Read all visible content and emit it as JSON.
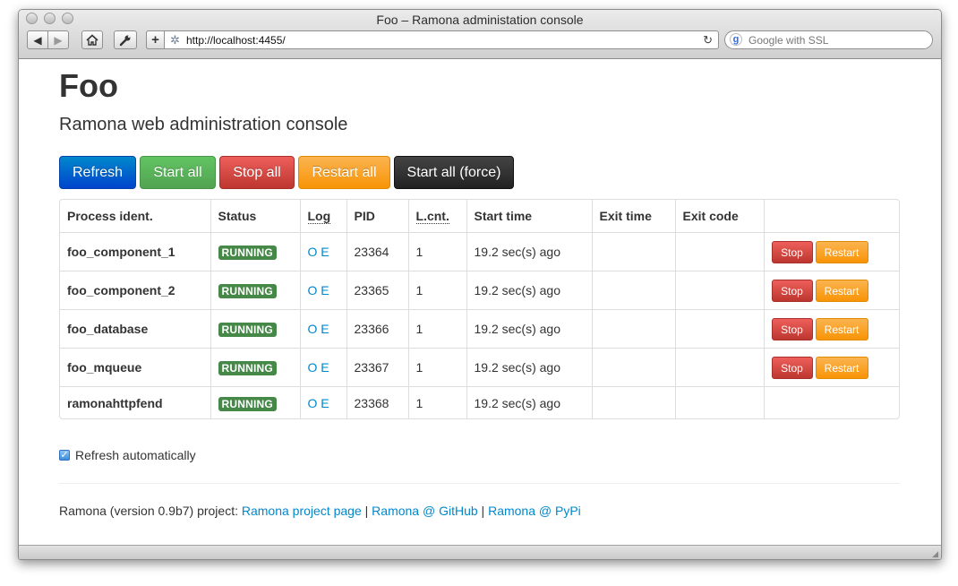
{
  "browser": {
    "title": "Foo – Ramona administation console",
    "url": "http://localhost:4455/",
    "search_placeholder": "Google with SSL"
  },
  "page": {
    "heading": "Foo",
    "subtitle": "Ramona web administration console",
    "buttons": {
      "refresh": "Refresh",
      "start_all": "Start all",
      "stop_all": "Stop all",
      "restart_all": "Restart all",
      "start_all_force": "Start all (force)"
    },
    "table": {
      "headers": [
        "Process ident.",
        "Status",
        "Log",
        "PID",
        "L.cnt.",
        "Start time",
        "Exit time",
        "Exit code",
        ""
      ],
      "rows": [
        {
          "name": "foo_component_1",
          "status": "RUNNING",
          "log_o": "O",
          "log_e": "E",
          "pid": "23364",
          "lcnt": "1",
          "start": "19.2 sec(s) ago",
          "exit_time": "",
          "exit_code": "",
          "stop": "Stop",
          "restart": "Restart"
        },
        {
          "name": "foo_component_2",
          "status": "RUNNING",
          "log_o": "O",
          "log_e": "E",
          "pid": "23365",
          "lcnt": "1",
          "start": "19.2 sec(s) ago",
          "exit_time": "",
          "exit_code": "",
          "stop": "Stop",
          "restart": "Restart"
        },
        {
          "name": "foo_database",
          "status": "RUNNING",
          "log_o": "O",
          "log_e": "E",
          "pid": "23366",
          "lcnt": "1",
          "start": "19.2 sec(s) ago",
          "exit_time": "",
          "exit_code": "",
          "stop": "Stop",
          "restart": "Restart"
        },
        {
          "name": "foo_mqueue",
          "status": "RUNNING",
          "log_o": "O",
          "log_e": "E",
          "pid": "23367",
          "lcnt": "1",
          "start": "19.2 sec(s) ago",
          "exit_time": "",
          "exit_code": "",
          "stop": "Stop",
          "restart": "Restart"
        },
        {
          "name": "ramonahttpfend",
          "status": "RUNNING",
          "log_o": "O",
          "log_e": "E",
          "pid": "23368",
          "lcnt": "1",
          "start": "19.2 sec(s) ago",
          "exit_time": "",
          "exit_code": ""
        }
      ]
    },
    "auto_refresh": {
      "label": "Refresh automatically",
      "checked": true
    },
    "footer": {
      "prefix": "Ramona (version 0.9b7) project: ",
      "link1": "Ramona project page",
      "sep": " | ",
      "link2": "Ramona @ GitHub",
      "link3": "Ramona @ PyPi"
    }
  },
  "colors": {
    "primary": "#0088cc",
    "success": "#51a351",
    "danger": "#bd362f",
    "warning": "#f89406",
    "inverse": "#222222",
    "label_success": "#468847"
  },
  "icons": [
    "back-icon",
    "forward-icon",
    "home-icon",
    "wrench-icon",
    "plus-icon",
    "gear-icon",
    "reload-icon",
    "google-icon",
    "checkbox-check-icon"
  ]
}
